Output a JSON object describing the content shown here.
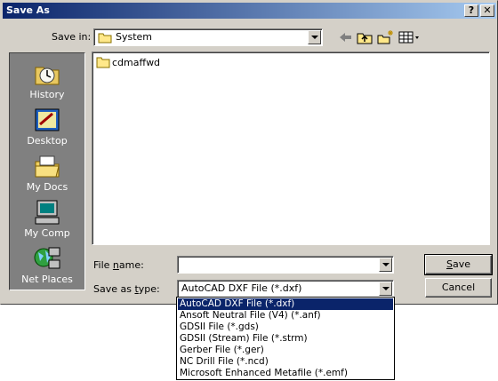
{
  "window": {
    "title": "Save As",
    "help_label": "?",
    "close_label": "✕"
  },
  "toolbar": {
    "save_in_label": "Save in:",
    "save_in_value": "System",
    "icons": [
      "back-arrow-icon",
      "up-folder-icon",
      "new-folder-icon",
      "view-menu-icon"
    ]
  },
  "places": [
    {
      "label": "History",
      "icon": "history-icon"
    },
    {
      "label": "Desktop",
      "icon": "desktop-icon"
    },
    {
      "label": "My Docs",
      "icon": "my-docs-icon"
    },
    {
      "label": "My Comp",
      "icon": "my-computer-icon"
    },
    {
      "label": "Net Places",
      "icon": "net-places-icon"
    }
  ],
  "files": [
    {
      "name": "cdmaffwd",
      "icon": "folder-icon"
    }
  ],
  "form": {
    "file_name_label_pre": "File ",
    "file_name_label_u": "n",
    "file_name_label_post": "ame:",
    "file_name_value": "",
    "save_type_label_pre": "Save as ",
    "save_type_label_u": "t",
    "save_type_label_post": "ype:",
    "save_type_value": "AutoCAD DXF File (*.dxf)"
  },
  "buttons": {
    "save_u": "S",
    "save_rest": "ave",
    "cancel": "Cancel"
  },
  "type_options": [
    "AutoCAD DXF File (*.dxf)",
    "Ansoft Neutral File (V4) (*.anf)",
    "GDSII File (*.gds)",
    "GDSII (Stream) File (*.strm)",
    "Gerber File (*.ger)",
    "NC Drill File (*.ncd)",
    "Microsoft Enhanced Metafile (*.emf)"
  ],
  "selected_type_index": 0,
  "colors": {
    "title_gradient_start": "#0a246a",
    "title_gradient_end": "#a6caf0",
    "face": "#d4d0c8",
    "selection": "#0a246a"
  }
}
